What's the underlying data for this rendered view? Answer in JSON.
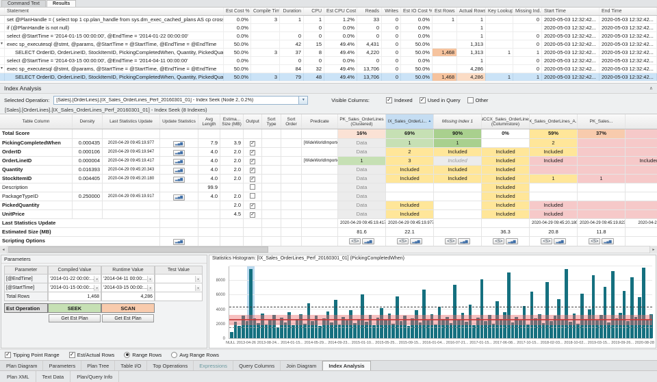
{
  "icons": {
    "check": "✓",
    "dropdown": "▼",
    "sort_asc": "▲",
    "expander": "▾",
    "chart": "▂▄▆",
    "scroll_left": "◄",
    "scroll_right": "►",
    "collapse": "∧",
    "cell_button": "▾"
  },
  "top_tabs": [
    {
      "label": "Command Text",
      "active": false
    },
    {
      "label": "Results",
      "active": true
    }
  ],
  "statement_grid": {
    "columns": [
      "Statement",
      "Est Cost %",
      "Compile Time",
      "Duration",
      "CPU",
      "Est CPU Cost %",
      "Reads",
      "Writes",
      "Est IO Cost %",
      "Est Rows",
      "Actual Rows",
      "Key Lookups",
      "Missing Ind...",
      "Start Time",
      "End Time"
    ],
    "rows": [
      {
        "statement": "set @PlanHandle = ( select top 1 cp.plan_handle from sys.dm_exec_cached_plans AS cp cross apply sys.dm_e...",
        "indent": 0,
        "expander": "",
        "values": [
          "0.0%",
          "3",
          "1",
          "1",
          "1.2%",
          "33",
          "0",
          "0.0%",
          "1",
          "1",
          "",
          "0",
          "2020-05-03 12:32:42...",
          "2020-05-03 12:32:42..."
        ]
      },
      {
        "statement": "if (@PlanHandle is not null)",
        "indent": 0,
        "expander": "",
        "values": [
          "0.0%",
          "",
          "",
          "0",
          "0.0%",
          "0",
          "0",
          "0.0%",
          "",
          "1",
          "",
          "",
          "2020-05-03 12:32:42...",
          "2020-05-03 12:32:42..."
        ]
      },
      {
        "statement": "select @StartTime = '2014-01-15 00:00:00', @EndTime = '2014-01-22 00:00:00'",
        "indent": 0,
        "expander": "",
        "values": [
          "0.0%",
          "",
          "0",
          "0",
          "0.0%",
          "0",
          "0",
          "0.0%",
          "",
          "1",
          "",
          "0",
          "2020-05-03 12:32:42...",
          "2020-05-03 12:32:42..."
        ]
      },
      {
        "statement": "exec sp_executesql @stmt, @params, @StartTime = @StartTime, @EndTime = @EndTime",
        "indent": 0,
        "expander": "▾",
        "values": [
          "50.0%",
          "",
          "42",
          "15",
          "49.4%",
          "4,431",
          "0",
          "50.0%",
          "",
          "1,313",
          "",
          "0",
          "2020-05-03 12:32:42...",
          "2020-05-03 12:32:42..."
        ]
      },
      {
        "statement": "SELECT OrderID, OrderLineID, StockItemID, PickingCompletedWhen, Quantity, PickedQuantity, UnitPrice F...",
        "indent": 1,
        "expander": "",
        "highlights": {
          "8": 1
        },
        "values": [
          "50.0%",
          "3",
          "37",
          "8",
          "49.4%",
          "4,220",
          "0",
          "50.0%",
          "1,468",
          "1,313",
          "1",
          "1",
          "2020-05-03 12:32:42...",
          "2020-05-03 12:32:42..."
        ]
      },
      {
        "statement": "select @StartTime = '2014-03-15 00:00:00', @EndTime = '2014-04-11 00:00:00'",
        "indent": 0,
        "expander": "",
        "values": [
          "0.0%",
          "",
          "0",
          "0",
          "0.0%",
          "0",
          "0",
          "0.0%",
          "",
          "1",
          "",
          "0",
          "2020-05-03 12:32:42...",
          "2020-05-03 12:32:42..."
        ]
      },
      {
        "statement": "exec sp_executesql @stmt, @params, @StartTime = @StartTime, @EndTime = @EndTime",
        "indent": 0,
        "expander": "▾",
        "values": [
          "50.0%",
          "",
          "84",
          "32",
          "49.4%",
          "13,706",
          "0",
          "50.0%",
          "",
          "4,286",
          "",
          "0",
          "2020-05-03 12:32:42...",
          "2020-05-03 12:32:42..."
        ]
      },
      {
        "statement": "SELECT OrderID, OrderLineID, StockItemID, PickingCompletedWhen, Quantity, PickedQuantity, UnitPrice F...",
        "indent": 1,
        "expander": "",
        "selected": true,
        "highlights": {
          "8": 1,
          "9": 2
        },
        "values": [
          "50.0%",
          "3",
          "79",
          "48",
          "49.4%",
          "13,706",
          "0",
          "50.0%",
          "1,468",
          "4,286",
          "1",
          "1",
          "2020-05-03 12:32:42...",
          "2020-05-03 12:32:42..."
        ]
      }
    ]
  },
  "index_analysis": {
    "title": "Index Analysis",
    "selected_operation_label": "Selected Operation:",
    "selected_operation": "[Sales].[OrderLines].[IX_Sales_OrderLines_Perf_20160301_01] - Index Seek (Node 2,  0.2%)",
    "visible_columns_label": "Visible Columns:",
    "visible_column_options": [
      {
        "label": "Indexed",
        "checked": true
      },
      {
        "label": "Used in Query",
        "checked": true
      },
      {
        "label": "Other",
        "checked": false
      }
    ],
    "subtitle": "[Sales].[OrderLines].[IX_Sales_OrderLines_Perf_20160301_01] - Index Seek (8 Indexes)",
    "table": {
      "fixed_columns": [
        "Table Column",
        "Density",
        "Last Statistics Update",
        "Update Statistics",
        "Avg Length",
        "Estima... Size (MB)",
        "Output",
        "Sort Type",
        "Sort Order",
        "Predicate"
      ],
      "index_columns": [
        {
          "name": "PK_Sales_OrderLines (Clustered)",
          "score": "16%",
          "score_bg": "#fbe2d5",
          "selected": false
        },
        {
          "name": "IX_Sales_OrderLi...",
          "sort_glyph": "▲",
          "score": "69%",
          "score_bg": "#c6e0b4",
          "selected": true
        },
        {
          "name": "Missing Index 1",
          "score": "90%",
          "score_bg": "#a9d08e",
          "italic": true
        },
        {
          "name": "NCCX_Sales_OrderLines (Columnstore)",
          "score": "0%",
          "score_bg": "#ffffff"
        },
        {
          "name": "IX_Sales_OrderLines_A...",
          "score": "59%",
          "score_bg": "#ffe699"
        },
        {
          "name": "PK_Sales...",
          "score": "37%",
          "score_bg": "#f8cbad"
        },
        {
          "name": "",
          "score": "",
          "score_bg": "#f6c9c9"
        }
      ],
      "total_score_label": "Total Score",
      "rows": [
        {
          "name": "PickingCompletedWhen",
          "bold": true,
          "density": "0.000435",
          "last_stats": "2020-04-29 09:45:19.977",
          "update_btn": true,
          "avg_len": "7.9",
          "est_size": "3.9",
          "output": "checked",
          "sort_type": "",
          "sort_order": "",
          "predicate": "[WideWorldImporters].[Sal...",
          "cells": [
            {
              "t": "Data",
              "c": "data"
            },
            {
              "t": "1",
              "c": "g1"
            },
            {
              "t": "1",
              "c": "g2"
            },
            {
              "t": "",
              "c": ""
            },
            {
              "t": "2",
              "c": "y"
            },
            {
              "t": "",
              "c": "p"
            },
            {
              "t": "",
              "c": "p"
            }
          ]
        },
        {
          "name": "OrderID",
          "bold": true,
          "density": "0.000106",
          "last_stats": "2020-04-29 09:45:19.947",
          "update_btn": true,
          "avg_len": "4.0",
          "est_size": "2.0",
          "output": "checked",
          "sort_type": "",
          "sort_order": "",
          "predicate": "",
          "cells": [
            {
              "t": "Data",
              "c": "data"
            },
            {
              "t": "2",
              "c": "y"
            },
            {
              "t": "Included",
              "c": "y"
            },
            {
              "t": "Included",
              "c": "y"
            },
            {
              "t": "Included",
              "c": "y"
            },
            {
              "t": "",
              "c": "p"
            },
            {
              "t": "",
              "c": "p"
            }
          ]
        },
        {
          "name": "OrderLineID",
          "bold": true,
          "density": "0.000004",
          "last_stats": "2020-04-29 09:45:19.417",
          "update_btn": true,
          "avg_len": "4.0",
          "est_size": "2.0",
          "output": "checked",
          "sort_type": "",
          "sort_order": "",
          "predicate": "[WideWorldImporters].[Sal...",
          "cells": [
            {
              "t": "1",
              "c": "g1"
            },
            {
              "t": "3",
              "c": "y"
            },
            {
              "t": "Included",
              "c": "gi"
            },
            {
              "t": "Included",
              "c": "y"
            },
            {
              "t": "Included",
              "c": "p"
            },
            {
              "t": "",
              "c": "p"
            },
            {
              "t": "Included",
              "c": "p"
            }
          ]
        },
        {
          "name": "Quantity",
          "bold": true,
          "density": "0.016393",
          "last_stats": "2020-04-29 09:45:20.343",
          "update_btn": true,
          "avg_len": "4.0",
          "est_size": "2.0",
          "output": "checked",
          "sort_type": "",
          "sort_order": "",
          "predicate": "",
          "cells": [
            {
              "t": "Data",
              "c": "data"
            },
            {
              "t": "Included",
              "c": "y"
            },
            {
              "t": "Included",
              "c": "y"
            },
            {
              "t": "Included",
              "c": "y"
            },
            {
              "t": "",
              "c": "p"
            },
            {
              "t": "",
              "c": "p"
            },
            {
              "t": "",
              "c": "p"
            }
          ]
        },
        {
          "name": "StockItemID",
          "bold": true,
          "density": "0.004405",
          "last_stats": "2020-04-29 09:45:20.180",
          "update_btn": true,
          "avg_len": "4.0",
          "est_size": "2.0",
          "output": "checked",
          "sort_type": "",
          "sort_order": "",
          "predicate": "",
          "cells": [
            {
              "t": "Data",
              "c": "data"
            },
            {
              "t": "Included",
              "c": "y"
            },
            {
              "t": "Included",
              "c": "y"
            },
            {
              "t": "Included",
              "c": "y"
            },
            {
              "t": "1",
              "c": "y"
            },
            {
              "t": "1",
              "c": "p"
            },
            {
              "t": "",
              "c": "p"
            }
          ]
        },
        {
          "name": "Description",
          "bold": false,
          "density": "",
          "last_stats": "",
          "update_btn": false,
          "avg_len": "99.9",
          "est_size": "",
          "output": "unchecked",
          "sort_type": "",
          "sort_order": "",
          "predicate": "",
          "cells": [
            {
              "t": "Data",
              "c": "data"
            },
            {
              "t": "",
              "c": ""
            },
            {
              "t": "",
              "c": ""
            },
            {
              "t": "Included",
              "c": "y"
            },
            {
              "t": "",
              "c": ""
            },
            {
              "t": "",
              "c": ""
            },
            {
              "t": "",
              "c": ""
            }
          ]
        },
        {
          "name": "PackageTypeID",
          "bold": false,
          "density": "0.250000",
          "last_stats": "2020-04-29 09:45:19.917",
          "update_btn": true,
          "avg_len": "4.0",
          "est_size": "2.0",
          "output": "unchecked",
          "sort_type": "",
          "sort_order": "",
          "predicate": "",
          "cells": [
            {
              "t": "Data",
              "c": "data"
            },
            {
              "t": "",
              "c": ""
            },
            {
              "t": "",
              "c": ""
            },
            {
              "t": "Included",
              "c": "y"
            },
            {
              "t": "",
              "c": ""
            },
            {
              "t": "",
              "c": ""
            },
            {
              "t": "",
              "c": ""
            }
          ]
        },
        {
          "name": "PickedQuantity",
          "bold": true,
          "density": "",
          "last_stats": "",
          "update_btn": false,
          "avg_len": "",
          "est_size": "2.0",
          "output": "checked",
          "sort_type": "",
          "sort_order": "",
          "predicate": "",
          "cells": [
            {
              "t": "Data",
              "c": "data"
            },
            {
              "t": "Included",
              "c": "y"
            },
            {
              "t": "",
              "c": ""
            },
            {
              "t": "Included",
              "c": "y"
            },
            {
              "t": "Included",
              "c": "p"
            },
            {
              "t": "",
              "c": "p"
            },
            {
              "t": "",
              "c": "p"
            }
          ]
        },
        {
          "name": "UnitPrice",
          "bold": true,
          "density": "",
          "last_stats": "",
          "update_btn": false,
          "avg_len": "",
          "est_size": "4.5",
          "output": "checked",
          "sort_type": "",
          "sort_order": "",
          "predicate": "",
          "cells": [
            {
              "t": "Data",
              "c": "data"
            },
            {
              "t": "Included",
              "c": "y"
            },
            {
              "t": "",
              "c": ""
            },
            {
              "t": "Included",
              "c": "y"
            },
            {
              "t": "Included",
              "c": "p"
            },
            {
              "t": "",
              "c": "p"
            },
            {
              "t": "",
              "c": "p"
            }
          ]
        }
      ],
      "footer": {
        "last_stats_label": "Last Statistics Update",
        "last_stats": [
          "2020-04-29 09:45:19.417",
          "2020-04-29 09:45:19.977",
          "",
          "",
          "2020-04-29 09:45:20.180",
          "2020-04-29 09:45:19.823",
          "2020-04-2..."
        ],
        "est_size_label": "Estimated Size (MB)",
        "est_sizes": [
          "81.6",
          "22.1",
          "",
          "36.3",
          "20.8",
          "11.8",
          ""
        ],
        "scripting_label": "Scripting Options",
        "script_btn": "<S>"
      }
    }
  },
  "parameters_panel": {
    "title": "Parameters",
    "columns": [
      "Parameter",
      "Compiled Value",
      "Runtime Value",
      "Test Value"
    ],
    "rows": [
      {
        "name": "[@EndTime]",
        "compiled": "'2014-01-22 00:00:...",
        "runtime": "'2014-04-11 00:00:...",
        "test": ""
      },
      {
        "name": "[@StartTime]",
        "compiled": "'2014-01-15 00:00:...",
        "runtime": "'2014-03-15 00:00:...",
        "test": ""
      }
    ],
    "total_rows_label": "Total Rows",
    "total_rows": {
      "compiled": "1,468",
      "runtime": "4,286",
      "test": ""
    },
    "est_operation_label": "Est Operation",
    "est_operation": {
      "compiled": "SEEK",
      "runtime": "SCAN"
    },
    "get_plan_label": "Get Est Plan"
  },
  "chart_data": {
    "type": "bar",
    "title": "Statistics Histogram: [IX_Sales_OrderLines_Perf_20160301_01] (PickingCompletedWhen)",
    "ylabel": "",
    "ylim": [
      0,
      10000
    ],
    "yticks": [
      0,
      2000,
      4000,
      6000,
      8000
    ],
    "x_labels": [
      "NULL",
      "2013-04-26",
      "2013-08-24...",
      "2014-01-15...",
      "2014-05-29...",
      "2014-09-23...",
      "2015-01-10...",
      "2015-05-25...",
      "2015-09-15...",
      "2016-01-04...",
      "2016-07-21...",
      "2017-01-15...",
      "2017-06-08...",
      "2017-10-15...",
      "2018-02-03...",
      "2018-10-02...",
      "2019-03-15...",
      "2019-09-26...",
      "2020-08-28"
    ],
    "bar_color": "#15707f",
    "highlighted_index": 5,
    "highlight_color": "#aed2ec",
    "tipping_range": [
      1800,
      3200
    ],
    "tipping_center_line": 2500,
    "est_rows_line": 1468,
    "actual_rows_line": 4286,
    "grid": true,
    "legend_position": "none",
    "values": [
      900,
      2300,
      1700,
      3100,
      2400,
      9600,
      2800,
      2100,
      3400,
      1900,
      2600,
      3200,
      1500,
      2900,
      2200,
      3600,
      1800,
      2700,
      3300,
      2000,
      4900,
      2400,
      3100,
      1700,
      2800,
      3700,
      2200,
      5300,
      1900,
      3000,
      2500,
      3900,
      2100,
      2700,
      6100,
      2300,
      3200,
      1800,
      2900,
      4200,
      2600,
      3400,
      2000,
      5800,
      2400,
      3100,
      1700,
      2800,
      3900,
      2200,
      6800,
      2500,
      3300,
      1900,
      4400,
      2700,
      3000,
      2100,
      7400,
      2600,
      3500,
      2300,
      4700,
      1800,
      2900,
      8200,
      2400,
      3200,
      2000,
      5100,
      2700,
      3600,
      9100,
      2200,
      3000,
      2500,
      4500,
      1900,
      6500,
      2800,
      3300,
      2100,
      7800,
      2400,
      3100,
      5400,
      2600,
      9600,
      2300,
      3400,
      2000,
      6200,
      2700,
      4000,
      8800,
      2500,
      3200,
      7100,
      2200,
      9300,
      2800,
      3500,
      6600,
      2400,
      8500,
      3000,
      5700,
      9800,
      2600,
      3300
    ]
  },
  "histogram_controls": [
    {
      "type": "checkbox",
      "label": "Tipping Point Range",
      "checked": true
    },
    {
      "type": "checkbox",
      "label": "Est/Actual Rows",
      "checked": true
    },
    {
      "type": "radio",
      "label": "Range Rows",
      "checked": true
    },
    {
      "type": "radio",
      "label": "Avg Range Rows",
      "checked": false
    }
  ],
  "doc_tabs": [
    {
      "label": "Plan Diagram"
    },
    {
      "label": "Parameters"
    },
    {
      "label": "Plan Tree"
    },
    {
      "label": "Table I/O"
    },
    {
      "label": "Top Operations"
    },
    {
      "label": "Expressions",
      "disabled": true
    },
    {
      "label": "Query Columns"
    },
    {
      "label": "Join Diagram"
    },
    {
      "label": "Index Analysis",
      "active": true
    }
  ],
  "bottom_tabs": [
    {
      "label": "Plan XML"
    },
    {
      "label": "Text Data"
    },
    {
      "label": "Plan/Query Info"
    }
  ]
}
